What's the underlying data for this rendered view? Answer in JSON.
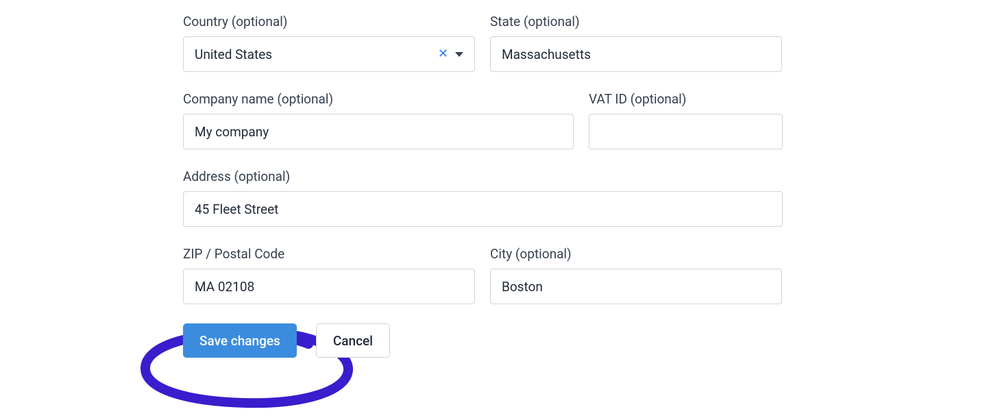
{
  "form": {
    "country": {
      "label": "Country (optional)",
      "value": "United States"
    },
    "state": {
      "label": "State (optional)",
      "value": "Massachusetts"
    },
    "company": {
      "label": "Company name (optional)",
      "value": "My company"
    },
    "vat": {
      "label": "VAT ID (optional)",
      "value": ""
    },
    "address": {
      "label": "Address (optional)",
      "value": "45 Fleet Street"
    },
    "zip": {
      "label": "ZIP / Postal Code",
      "value": "MA 02108"
    },
    "city": {
      "label": "City (optional)",
      "value": "Boston"
    }
  },
  "buttons": {
    "save": "Save changes",
    "cancel": "Cancel"
  },
  "colors": {
    "annotation": "#3a1dcc",
    "primary_button": "#3b8cde",
    "border": "#cfd4da",
    "clear_icon": "#2f80ed"
  }
}
